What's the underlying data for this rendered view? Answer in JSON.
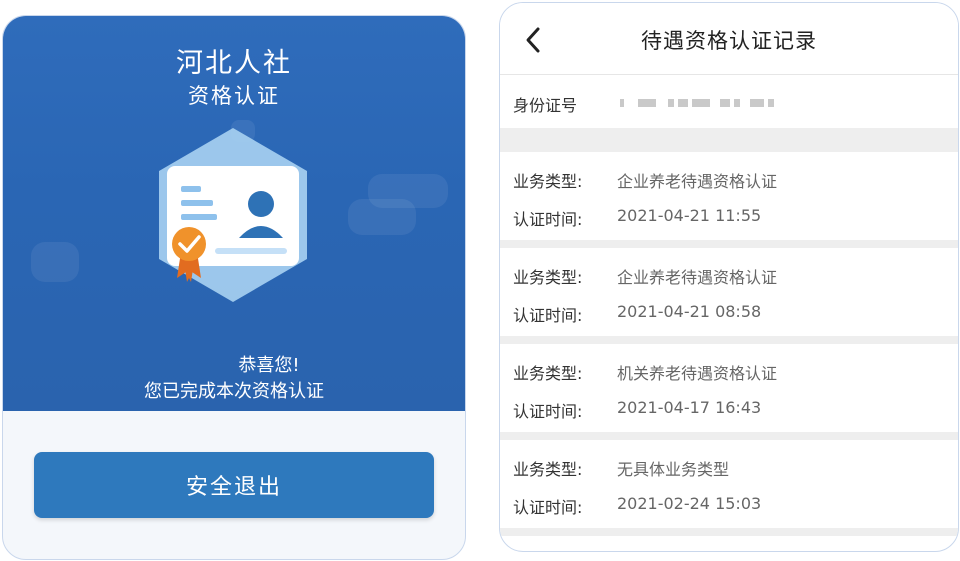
{
  "left_panel": {
    "title": "河北人社",
    "subtitle": "资格认证",
    "congrats_line1": "恭喜您!",
    "congrats_line2": "您已完成本次资格认证",
    "exit_button": "安全退出",
    "icon": "certificate-badge-icon",
    "colors": {
      "header_blue": "#2a66b4",
      "button_blue": "#2e79bd",
      "badge_orange": "#f0922b"
    }
  },
  "right_panel": {
    "title": "待遇资格认证记录",
    "back_icon": "chevron-left-icon",
    "id_label": "身份证号",
    "type_label": "业务类型:",
    "time_label": "认证时间:",
    "records": [
      {
        "type": "企业养老待遇资格认证",
        "time": "2021-04-21 11:55"
      },
      {
        "type": "企业养老待遇资格认证",
        "time": "2021-04-21 08:58"
      },
      {
        "type": "机关养老待遇资格认证",
        "time": "2021-04-17 16:43"
      },
      {
        "type": "无具体业务类型",
        "time": "2021-02-24 15:03"
      }
    ]
  }
}
